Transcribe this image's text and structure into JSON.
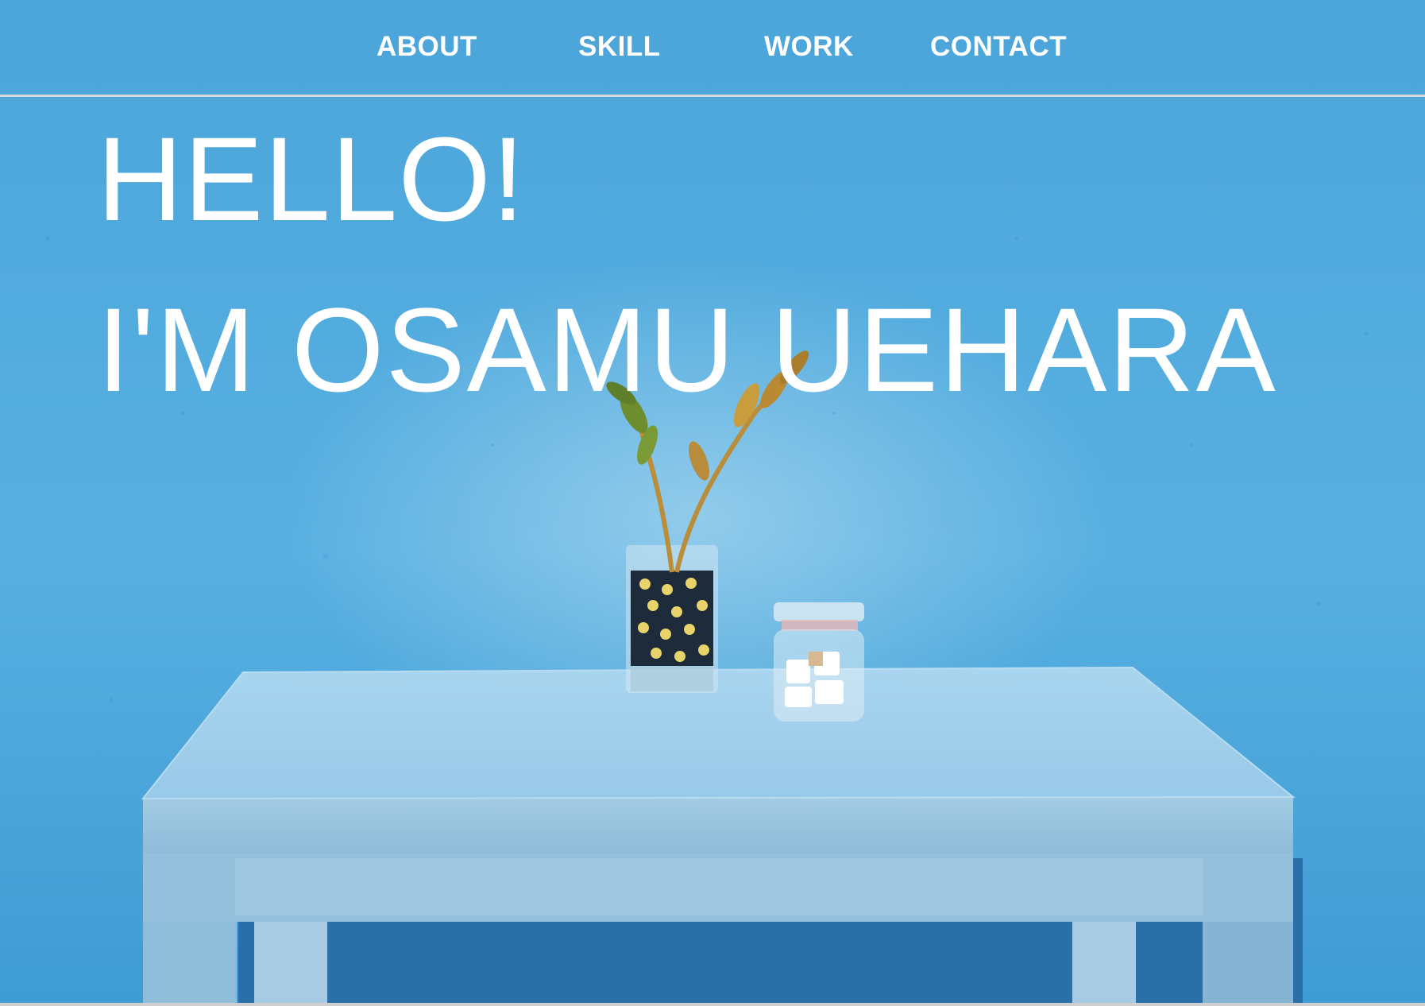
{
  "nav": {
    "items": [
      {
        "label": "ABOUT"
      },
      {
        "label": "SKILL"
      },
      {
        "label": "WORK"
      },
      {
        "label": "CONTACT"
      }
    ]
  },
  "hero": {
    "greeting": "HELLO!",
    "name": "I'M OSAMU UEHARA",
    "photo": {
      "subject": "blue table with plant vase and glass jar against blue wall",
      "colors": {
        "wall": "#4fa8dc",
        "table": "#9fcbe6",
        "text": "#ffffff"
      }
    }
  }
}
